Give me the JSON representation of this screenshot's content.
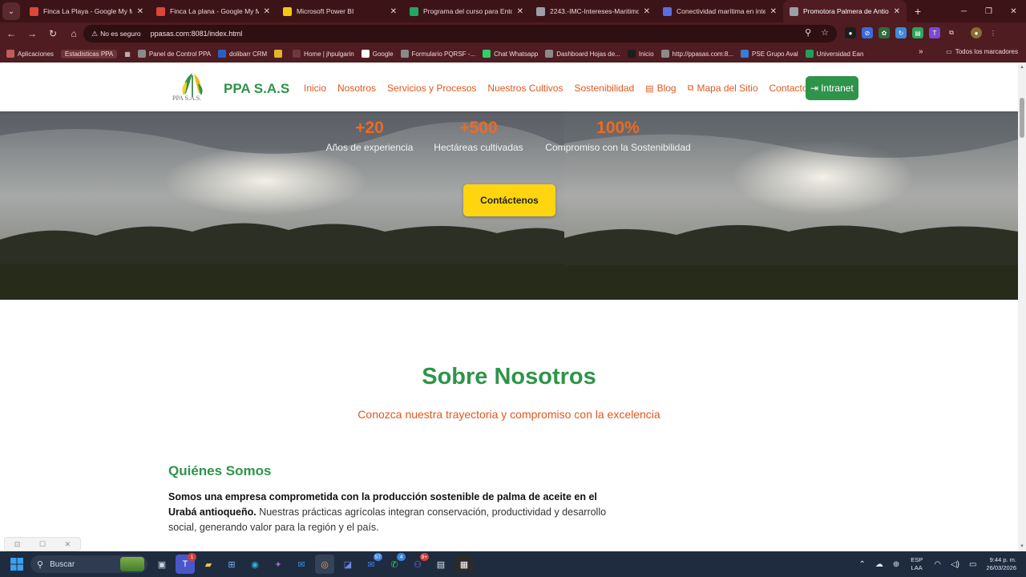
{
  "browser": {
    "tabs": [
      {
        "title": "Finca La Playa - Google My Ma",
        "icon": "maps-pin-icon",
        "color": "#e0453a"
      },
      {
        "title": "Finca La plana - Google My M",
        "icon": "maps-pin-icon",
        "color": "#e0453a"
      },
      {
        "title": "Microsoft Power BI",
        "icon": "power-bi-icon",
        "color": "#f2c811"
      },
      {
        "title": "Programa del curso para Ento",
        "icon": "sheets-icon",
        "color": "#23a566"
      },
      {
        "title": "2243.-IMC-Intereses-Maritimo",
        "icon": "page-icon",
        "color": "#9aa0a6"
      },
      {
        "title": "Conectividad marítima en inte",
        "icon": "ai-icon",
        "color": "#5b6ee1"
      },
      {
        "title": "Promotora Palmera de Antioqu",
        "icon": "globe-icon",
        "color": "#9aa0a6"
      }
    ],
    "security_label": "No es seguro",
    "url": "ppasas.com:8081/index.html",
    "bookmarks": [
      {
        "label": "Aplicaciones",
        "chip": false
      },
      {
        "label": "Estadisticas PPA",
        "chip": true
      },
      {
        "label": "Panel de Control PPA",
        "chip": false
      },
      {
        "label": "dolibarr CRM",
        "chip": false
      },
      {
        "label": "",
        "chip": false
      },
      {
        "label": "Home | jhpulgarin",
        "chip": false
      },
      {
        "label": "Google",
        "chip": false
      },
      {
        "label": "Formulario PQRSF -...",
        "chip": false
      },
      {
        "label": "Chat Whatsapp",
        "chip": false
      },
      {
        "label": "Dashboard Hojas de...",
        "chip": false
      },
      {
        "label": "Inicio",
        "chip": false
      },
      {
        "label": "http://ppasas.com:8...",
        "chip": false
      },
      {
        "label": "PSE Grupo Aval",
        "chip": false
      },
      {
        "label": "Universidad Ean",
        "chip": false
      }
    ],
    "all_bookmarks": "Todos los marcadores"
  },
  "site": {
    "logo_text": "PPA S.A.S.",
    "brand": "PPA S.A.S",
    "menu": [
      {
        "label": "Inicio",
        "icon": ""
      },
      {
        "label": "Nosotros",
        "icon": ""
      },
      {
        "label": "Servicios y Procesos",
        "icon": ""
      },
      {
        "label": "Nuestros Cultivos",
        "icon": ""
      },
      {
        "label": "Sostenibilidad",
        "icon": ""
      },
      {
        "label": "Blog",
        "icon": "blog-icon"
      },
      {
        "label": "Mapa del Sitio",
        "icon": "sitemap-icon"
      },
      {
        "label": "Contacto",
        "icon": ""
      }
    ],
    "intranet": "Intranet",
    "colors": {
      "green": "#2e9449",
      "orange": "#e0581d",
      "yellow": "#ffd510"
    }
  },
  "hero": {
    "stats": [
      {
        "number": "+20",
        "label": "Años de experiencia"
      },
      {
        "number": "+500",
        "label": "Hectáreas cultivadas"
      },
      {
        "number": "100%",
        "label": "Compromiso con la Sostenibilidad"
      }
    ],
    "cta": "Contáctenos"
  },
  "about": {
    "title": "Sobre Nosotros",
    "subtitle": "Conozca nuestra trayectoria y compromiso con la excelencia",
    "who_title": "Quiénes Somos",
    "who_bold": "Somos una empresa comprometida con la producción sostenible de palma de aceite en el Urabá antioqueño.",
    "who_text": " Nuestras prácticas agrícolas integran conservación, productividad y desarrollo social, generando valor para la región y el país."
  },
  "taskbar": {
    "search": "Buscar",
    "badges": {
      "teams": "1",
      "mail": "57",
      "whatsapp": "4",
      "teams2": "9+"
    },
    "lang_top": "ESP",
    "lang_bottom": "LAA",
    "time": "9:44 p. m.",
    "date": "26/03/2026"
  }
}
